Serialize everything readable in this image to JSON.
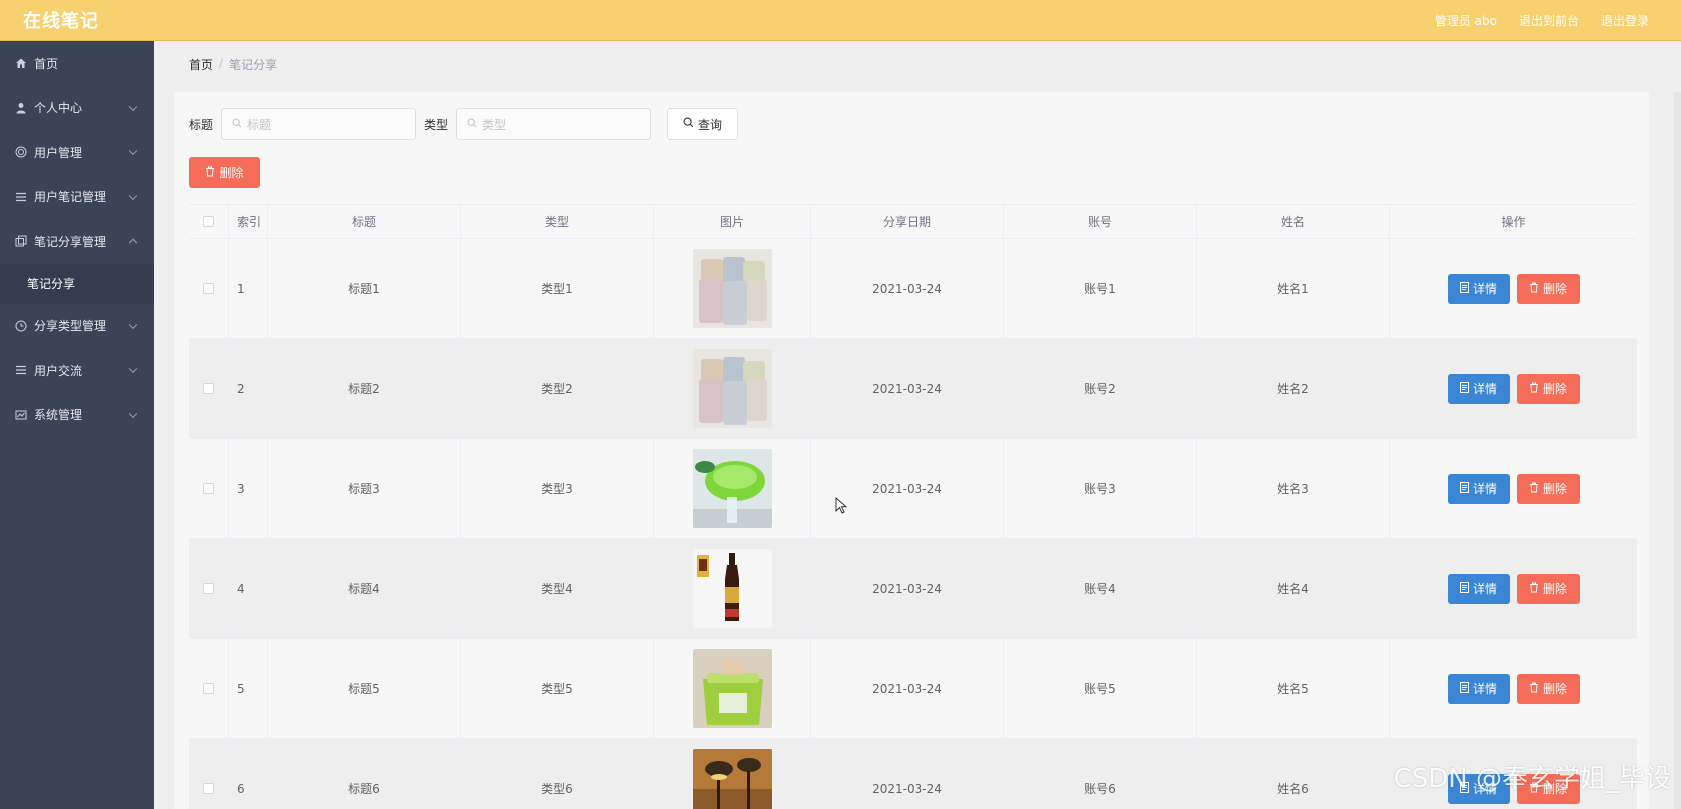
{
  "header": {
    "brand": "在线笔记",
    "admin": "管理员 abo",
    "back_front": "退出到前台",
    "logout": "退出登录"
  },
  "sidebar": {
    "items": [
      {
        "label": "首页",
        "icon": "home-icon"
      },
      {
        "label": "个人中心",
        "icon": "user-icon"
      },
      {
        "label": "用户管理",
        "icon": "target-icon"
      },
      {
        "label": "用户笔记管理",
        "icon": "list-icon"
      },
      {
        "label": "笔记分享管理",
        "icon": "copy-icon"
      },
      {
        "label": "分享类型管理",
        "icon": "clock-icon"
      },
      {
        "label": "用户交流",
        "icon": "list-icon"
      },
      {
        "label": "系统管理",
        "icon": "chart-icon"
      }
    ],
    "active_sub": "笔记分享"
  },
  "breadcrumb": {
    "home": "首页",
    "sep": "/",
    "current": "笔记分享"
  },
  "search": {
    "title_label": "标题",
    "title_placeholder": "标题",
    "type_label": "类型",
    "type_placeholder": "类型",
    "query_label": "查询"
  },
  "toolbar": {
    "delete_label": "删除"
  },
  "table": {
    "headers": {
      "index": "索引",
      "title": "标题",
      "type": "类型",
      "image": "图片",
      "date": "分享日期",
      "account": "账号",
      "name": "姓名",
      "ops": "操作"
    },
    "rows": [
      {
        "index": "1",
        "title": "标题1",
        "type": "类型1",
        "date": "2021-03-24",
        "account": "账号1",
        "name": "姓名1",
        "image": "cups"
      },
      {
        "index": "2",
        "title": "标题2",
        "type": "类型2",
        "date": "2021-03-24",
        "account": "账号2",
        "name": "姓名2",
        "image": "cups"
      },
      {
        "index": "3",
        "title": "标题3",
        "type": "类型3",
        "date": "2021-03-24",
        "account": "账号3",
        "name": "姓名3",
        "image": "strainer"
      },
      {
        "index": "4",
        "title": "标题4",
        "type": "类型4",
        "date": "2021-03-24",
        "account": "账号4",
        "name": "姓名4",
        "image": "bottle"
      },
      {
        "index": "5",
        "title": "标题5",
        "type": "类型5",
        "date": "2021-03-24",
        "account": "账号5",
        "name": "姓名5",
        "image": "box"
      },
      {
        "index": "6",
        "title": "标题6",
        "type": "类型6",
        "date": "2021-03-24",
        "account": "账号6",
        "name": "姓名6",
        "image": "lamp"
      }
    ],
    "detail_label": "详情",
    "delete_label": "删除"
  },
  "watermark": "CSDN @奉玄学姐_毕设",
  "colors": {
    "header": "#f7d06f",
    "sidebar": "#3b4457",
    "primary": "#3a86d4",
    "danger": "#f56c58"
  }
}
